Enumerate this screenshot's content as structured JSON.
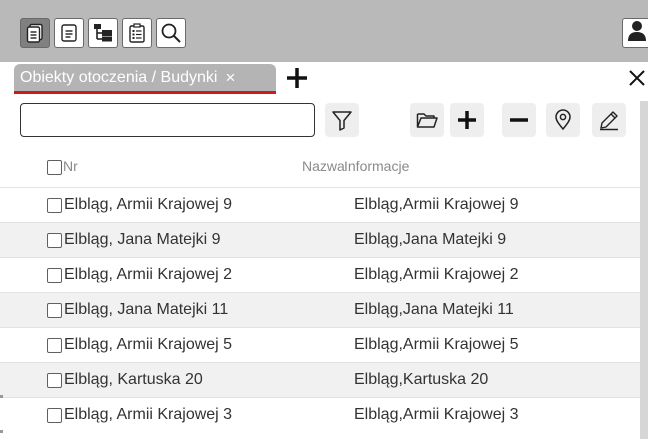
{
  "toolbar": {
    "buttons": [
      {
        "icon": "pages-icon",
        "active": true
      },
      {
        "icon": "document-icon",
        "active": false
      },
      {
        "icon": "tree-icon",
        "active": false
      },
      {
        "icon": "form-icon",
        "active": false
      },
      {
        "icon": "search-icon",
        "active": false
      }
    ],
    "user_icon": "user-icon"
  },
  "tabs": {
    "active": {
      "label": "Obiekty otoczenia / Budynki",
      "close": "×"
    },
    "add_icon": "plus-icon",
    "panel_close_icon": "close-icon"
  },
  "filter": {
    "value": "",
    "placeholder": ""
  },
  "actions": [
    "filter-icon",
    "folder-icon",
    "plus-icon",
    "minus-icon",
    "location-icon",
    "edit-icon"
  ],
  "table": {
    "columns": [
      "Nr",
      "Nazwa",
      "Informacje"
    ],
    "rows": [
      {
        "nr": "Elbląg, Armii Krajowej 9",
        "info": "Elbląg,Armii Krajowej 9"
      },
      {
        "nr": "Elbląg, Jana Matejki 9",
        "info": "Elbląg,Jana Matejki 9"
      },
      {
        "nr": "Elbląg, Armii Krajowej 2",
        "info": "Elbląg,Armii Krajowej 2"
      },
      {
        "nr": "Elbląg, Jana Matejki 11",
        "info": "Elbląg,Jana Matejki 11"
      },
      {
        "nr": "Elbląg, Armii Krajowej 5",
        "info": "Elbląg,Armii Krajowej 5"
      },
      {
        "nr": "Elbląg, Kartuska 20",
        "info": "Elbląg,Kartuska 20"
      },
      {
        "nr": "Elbląg, Armii Krajowej 3",
        "info": "Elbląg,Armii Krajowej 3"
      }
    ]
  },
  "colors": {
    "toolbar_bg": "#b9b9b9",
    "active_tab_bg": "#b4b4b4",
    "tab_underline": "#d01818",
    "alt_row": "#f1f1f1"
  }
}
